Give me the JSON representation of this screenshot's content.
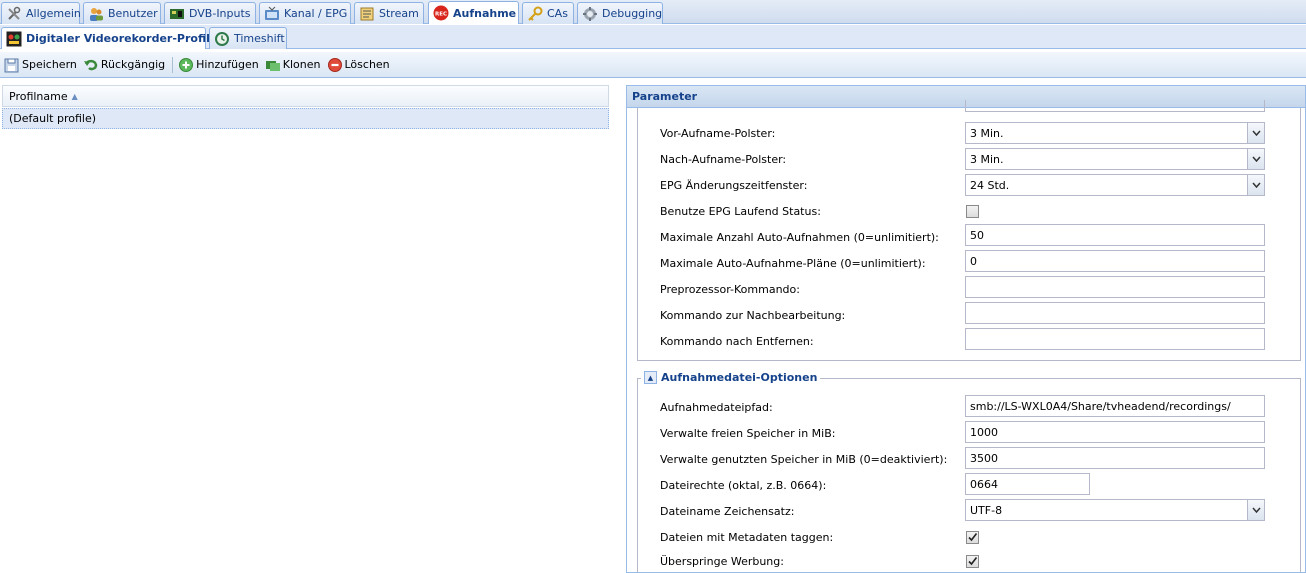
{
  "top_tabs": [
    {
      "label": "Allgemein",
      "icon": "wrench-icon"
    },
    {
      "label": "Benutzer",
      "icon": "users-icon"
    },
    {
      "label": "DVB-Inputs",
      "icon": "card-icon"
    },
    {
      "label": "Kanal / EPG",
      "icon": "tv-icon"
    },
    {
      "label": "Stream",
      "icon": "stream-icon"
    },
    {
      "label": "Aufnahme",
      "icon": "rec-icon",
      "active": true
    },
    {
      "label": "CAs",
      "icon": "key-icon"
    },
    {
      "label": "Debugging",
      "icon": "bug-icon"
    }
  ],
  "sub_tabs": [
    {
      "label": "Digitaler Videorekorder-Profile",
      "icon": "dvr-icon",
      "active": true
    },
    {
      "label": "Timeshift",
      "icon": "timeshift-icon"
    }
  ],
  "toolbar": {
    "save": "Speichern",
    "undo": "Rückgängig",
    "add": "Hinzufügen",
    "clone": "Klonen",
    "delete": "Löschen"
  },
  "grid": {
    "column": "Profilname",
    "rows": [
      "(Default profile)"
    ]
  },
  "panel": {
    "title": "Parameter",
    "fields": [
      {
        "label": "Vor-Aufname-Polster:",
        "type": "combo",
        "value": "3 Min."
      },
      {
        "label": "Nach-Aufname-Polster:",
        "type": "combo",
        "value": "3 Min."
      },
      {
        "label": "EPG Änderungszeitfenster:",
        "type": "combo",
        "value": "24 Std."
      },
      {
        "label": "Benutze EPG Laufend Status:",
        "type": "checkbox",
        "checked": false
      },
      {
        "label": "Maximale Anzahl Auto-Aufnahmen (0=unlimitiert):",
        "type": "text",
        "value": "50"
      },
      {
        "label": "Maximale Auto-Aufnahme-Pläne (0=unlimitiert):",
        "type": "text",
        "value": "0"
      },
      {
        "label": "Preprozessor-Kommando:",
        "type": "text",
        "value": ""
      },
      {
        "label": "Kommando zur Nachbearbeitung:",
        "type": "text",
        "value": ""
      },
      {
        "label": "Kommando nach Entfernen:",
        "type": "text",
        "value": ""
      }
    ],
    "section2_title": "Aufnahmedatei-Optionen",
    "fields2": [
      {
        "label": "Aufnahmedateipfad:",
        "type": "text",
        "value": "smb://LS-WXL0A4/Share/tvheadend/recordings/"
      },
      {
        "label": "Verwalte freien Speicher in MiB:",
        "type": "text",
        "value": "1000"
      },
      {
        "label": "Verwalte genutzten Speicher in MiB (0=deaktiviert):",
        "type": "text",
        "value": "3500"
      },
      {
        "label": "Dateirechte (oktal, z.B. 0664):",
        "type": "text",
        "value": "0664"
      },
      {
        "label": "Dateiname Zeichensatz:",
        "type": "combo",
        "value": "UTF-8"
      },
      {
        "label": "Dateien mit Metadaten taggen:",
        "type": "checkbox",
        "checked": true
      },
      {
        "label": "Überspringe Werbung:",
        "type": "checkbox",
        "checked": true
      }
    ]
  },
  "colors": {
    "tab_text": "#15428b",
    "border": "#99bbe8",
    "selected_row": "#dfe8f6"
  }
}
